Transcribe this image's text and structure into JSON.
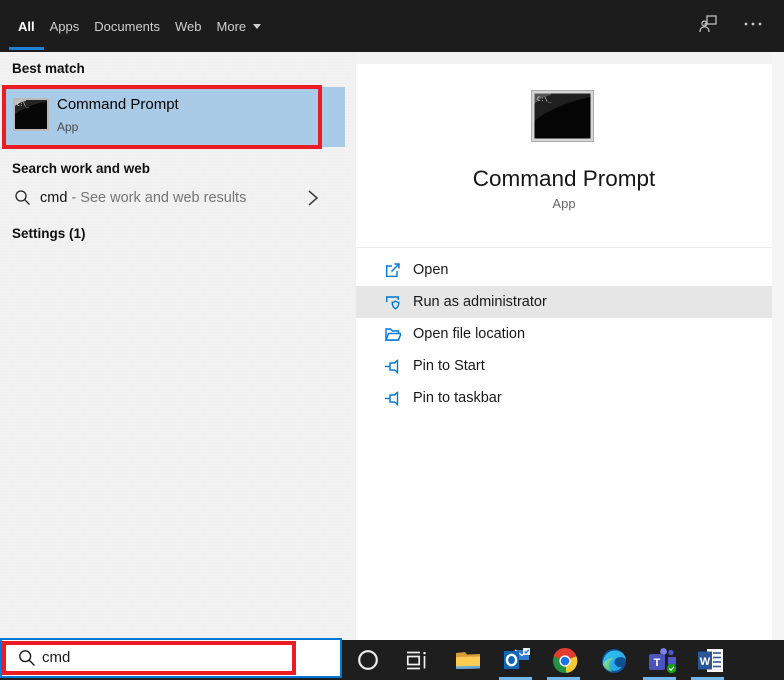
{
  "topbar": {
    "tabs": [
      {
        "label": "All",
        "active": true
      },
      {
        "label": "Apps",
        "active": false
      },
      {
        "label": "Documents",
        "active": false
      },
      {
        "label": "Web",
        "active": false
      },
      {
        "label": "More",
        "active": false,
        "has_caret": true
      }
    ],
    "icons": [
      "feedback-icon",
      "ellipsis-icon"
    ]
  },
  "left_panel": {
    "best_match_header": "Best match",
    "best_match": {
      "title": "Command Prompt",
      "subtitle": "App",
      "icon": "command-prompt-icon"
    },
    "search_web_header": "Search work and web",
    "web_result": {
      "query": "cmd",
      "suffix": "- See work and web results",
      "icon": "search-icon",
      "chevron": "chevron-right-icon"
    },
    "settings_header": "Settings (1)"
  },
  "preview_panel": {
    "icon": "command-prompt-icon-large",
    "title": "Command Prompt",
    "subtitle": "App",
    "actions": [
      {
        "label": "Open",
        "icon": "open-icon",
        "highlighted": false
      },
      {
        "label": "Run as administrator",
        "icon": "run-as-admin-icon",
        "highlighted": true
      },
      {
        "label": "Open file location",
        "icon": "file-location-icon",
        "highlighted": false
      },
      {
        "label": "Pin to Start",
        "icon": "pin-icon",
        "highlighted": false
      },
      {
        "label": "Pin to taskbar",
        "icon": "pin-icon",
        "highlighted": false
      }
    ]
  },
  "search_box": {
    "value": "cmd",
    "icon": "search-icon"
  },
  "taskbar": {
    "icons": [
      "cortana-icon",
      "task-view-icon",
      "file-explorer-icon",
      "outlook-icon",
      "chrome-icon",
      "edge-icon",
      "teams-icon",
      "word-icon"
    ],
    "running_apps": [
      "outlook",
      "chrome",
      "teams",
      "word"
    ]
  },
  "annotations": {
    "color": "#ec1c24",
    "boxes": [
      "best-match-item",
      "taskbar-search-box"
    ]
  },
  "colors": {
    "accent": "#0078d7",
    "highlight_row": "#a9cbe8",
    "topbar_bg": "#1c1c1c",
    "taskbar_bg": "#1e1e1e",
    "panel_bg": "#f2f2f2",
    "preview_bg": "#ffffff",
    "hover_row": "#e6e6e6"
  }
}
